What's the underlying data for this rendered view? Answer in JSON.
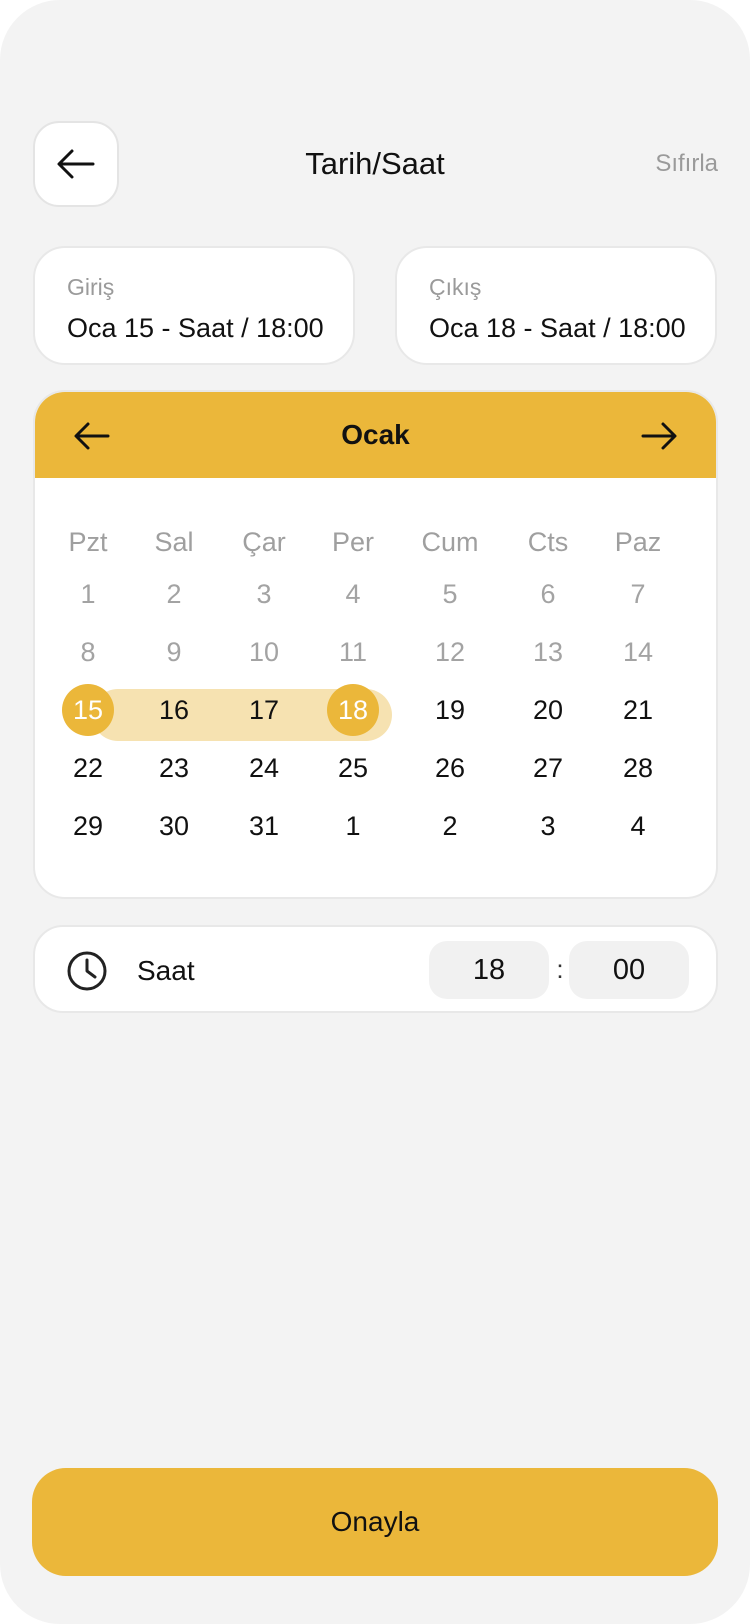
{
  "header": {
    "title": "Tarih/Saat",
    "reset_label": "Sıfırla",
    "back_icon": "arrow-left-icon"
  },
  "checkin": {
    "label": "Giriş",
    "value": "Oca 15 - Saat / 18:00"
  },
  "checkout": {
    "label": "Çıkış",
    "value": "Oca 18 - Saat / 18:00"
  },
  "calendar": {
    "month": "Ocak",
    "prev_icon": "arrow-left-icon",
    "next_icon": "arrow-right-icon",
    "weekdays": [
      "Pzt",
      "Sal",
      "Çar",
      "Per",
      "Cum",
      "Cts",
      "Paz"
    ],
    "weeks": [
      [
        "1",
        "2",
        "3",
        "4",
        "5",
        "6",
        "7"
      ],
      [
        "8",
        "9",
        "10",
        "11",
        "12",
        "13",
        "14"
      ],
      [
        "15",
        "16",
        "17",
        "18",
        "19",
        "20",
        "21"
      ],
      [
        "22",
        "23",
        "24",
        "25",
        "26",
        "27",
        "28"
      ],
      [
        "29",
        "30",
        "31",
        "1",
        "2",
        "3",
        "4"
      ]
    ],
    "range_start": "15",
    "range_end": "18",
    "accent_color": "#EBB73A",
    "range_color": "#F6E2B1"
  },
  "time": {
    "label": "Saat",
    "icon": "clock-icon",
    "hour": "18",
    "separator": ":",
    "minute": "00"
  },
  "confirm_label": "Onayla"
}
